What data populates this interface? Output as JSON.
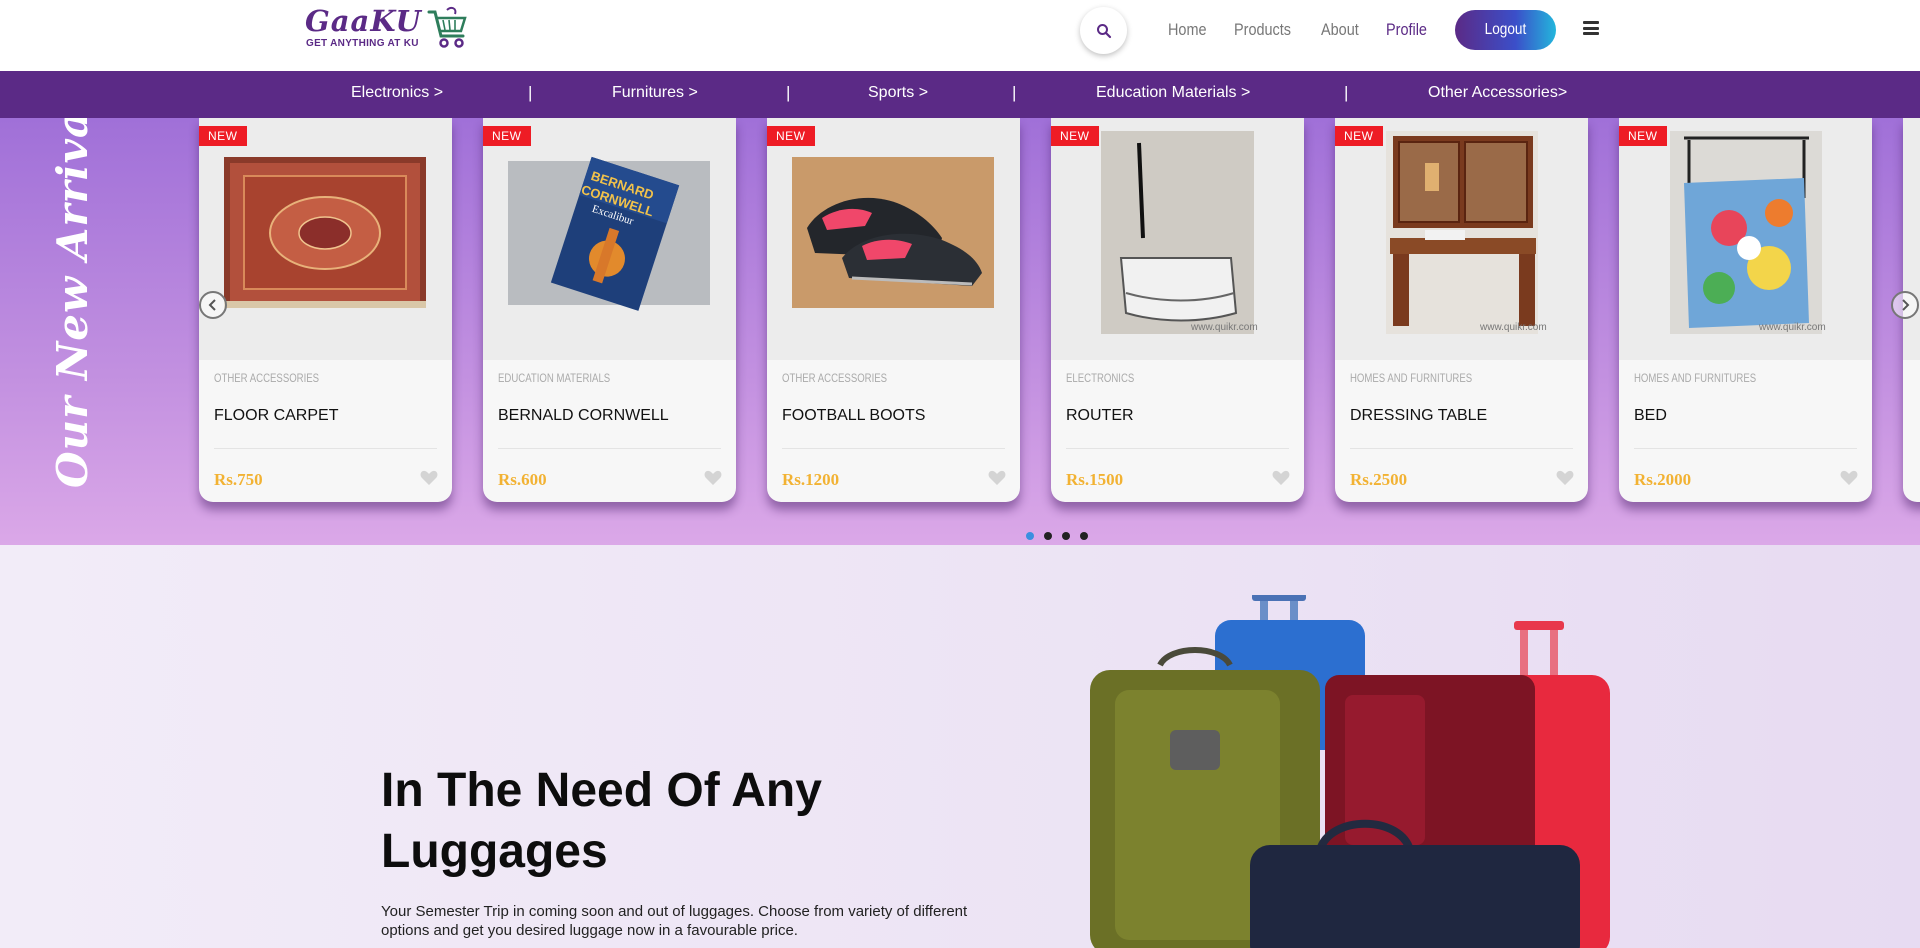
{
  "header": {
    "logo_text": "GaaKU",
    "logo_tagline": "GET ANYTHING AT KU",
    "nav": [
      {
        "label": "Home"
      },
      {
        "label": "Products"
      },
      {
        "label": "About"
      },
      {
        "label": "Profile"
      }
    ],
    "logout_label": "Logout"
  },
  "categories": [
    "Electronics >",
    "Furnitures >",
    "Sports >",
    "Education Materials >",
    "Other Accessories>"
  ],
  "arrivals": {
    "title": "Our New Arrivals",
    "products": [
      {
        "badge": "NEW",
        "category": "OTHER ACCESSORIES",
        "name": "FLOOR CARPET",
        "price": "Rs.750"
      },
      {
        "badge": "NEW",
        "category": "EDUCATION MATERIALS",
        "name": "BERNALD CORNWELL",
        "price": "Rs.600"
      },
      {
        "badge": "NEW",
        "category": "OTHER ACCESSORIES",
        "name": "FOOTBALL BOOTS",
        "price": "Rs.1200"
      },
      {
        "badge": "NEW",
        "category": "ELECTRONICS",
        "name": "ROUTER",
        "price": "Rs.1500"
      },
      {
        "badge": "NEW",
        "category": "HOMES AND FURNITURES",
        "name": "DRESSING TABLE",
        "price": "Rs.2500"
      },
      {
        "badge": "NEW",
        "category": "HOMES AND FURNITURES",
        "name": "BED",
        "price": "Rs.2000"
      }
    ],
    "book_cover_text": [
      "BERNARD",
      "CORNWELL",
      "Excalibur"
    ],
    "image_watermark": "www.quikr.com"
  },
  "hero": {
    "title": "In The Need Of Any Luggages",
    "text": "Your Semester Trip in coming soon and out of luggages. Choose from variety of different options and get you desired luggage now in a favourable price."
  },
  "colors": {
    "brand": "#5b2a86",
    "badge": "#ee1c25",
    "price": "#f2b233"
  }
}
